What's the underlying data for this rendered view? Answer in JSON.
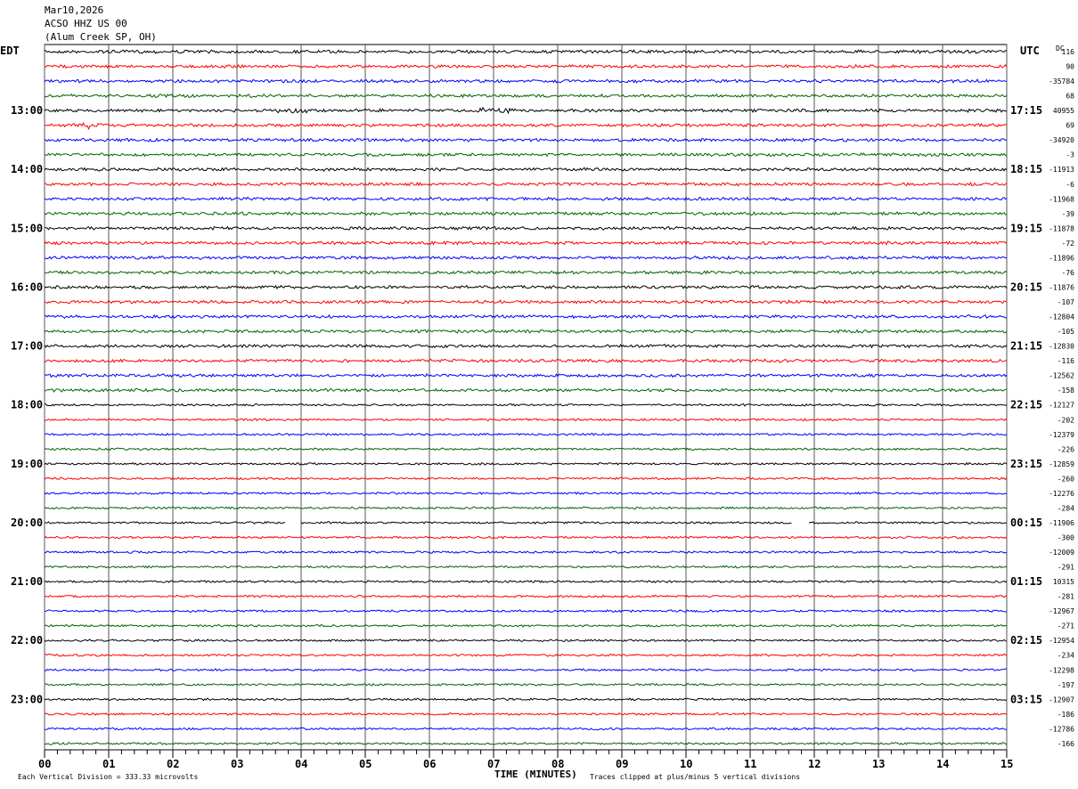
{
  "header": {
    "date": "Mar10,2026",
    "station": "ACSO HHZ US 00",
    "location": "(Alum Creek SP, OH)"
  },
  "left_label": "EDT",
  "right_label": "UTC",
  "dc_label": "DC",
  "footer": {
    "scale": "Each Vertical Division =  333.33 microvolts",
    "clip": "Traces clipped at plus/minus 5 vertical divisions"
  },
  "chart_data": {
    "type": "line",
    "subtype": "helicorder",
    "xlabel": "TIME (MINUTES)",
    "xlim": [
      0,
      15
    ],
    "x_ticks": [
      "00",
      "01",
      "02",
      "03",
      "04",
      "05",
      "06",
      "07",
      "08",
      "09",
      "10",
      "11",
      "12",
      "13",
      "14",
      "15"
    ],
    "grid": "vertical lines every minute",
    "trace_colors": [
      "#000000",
      "#ff0000",
      "#0000ff",
      "#006400"
    ],
    "edt_hour_labels": [
      "13:00",
      "14:00",
      "15:00",
      "16:00",
      "17:00",
      "18:00",
      "19:00",
      "20:00",
      "21:00",
      "22:00",
      "23:00"
    ],
    "utc_hour_labels": [
      "17:15",
      "18:15",
      "19:15",
      "20:15",
      "21:15",
      "22:15",
      "23:15",
      "00:15",
      "01:15",
      "02:15",
      "03:15"
    ],
    "dc_offsets": [
      116,
      90,
      -35784,
      68,
      40955,
      69,
      -34920,
      -3,
      -11913,
      -6,
      -11968,
      -39,
      -11878,
      -72,
      -11896,
      -76,
      -11876,
      -107,
      -12804,
      -105,
      -12830,
      -116,
      -12562,
      -158,
      -12127,
      -202,
      -12379,
      -226,
      -12859,
      -260,
      -12276,
      -284,
      -11906,
      -300,
      -12009,
      -291,
      10315,
      -281,
      -12967,
      -271,
      -12954,
      -234,
      -12298,
      -197,
      -12907,
      -186,
      -12786,
      -166
    ]
  }
}
